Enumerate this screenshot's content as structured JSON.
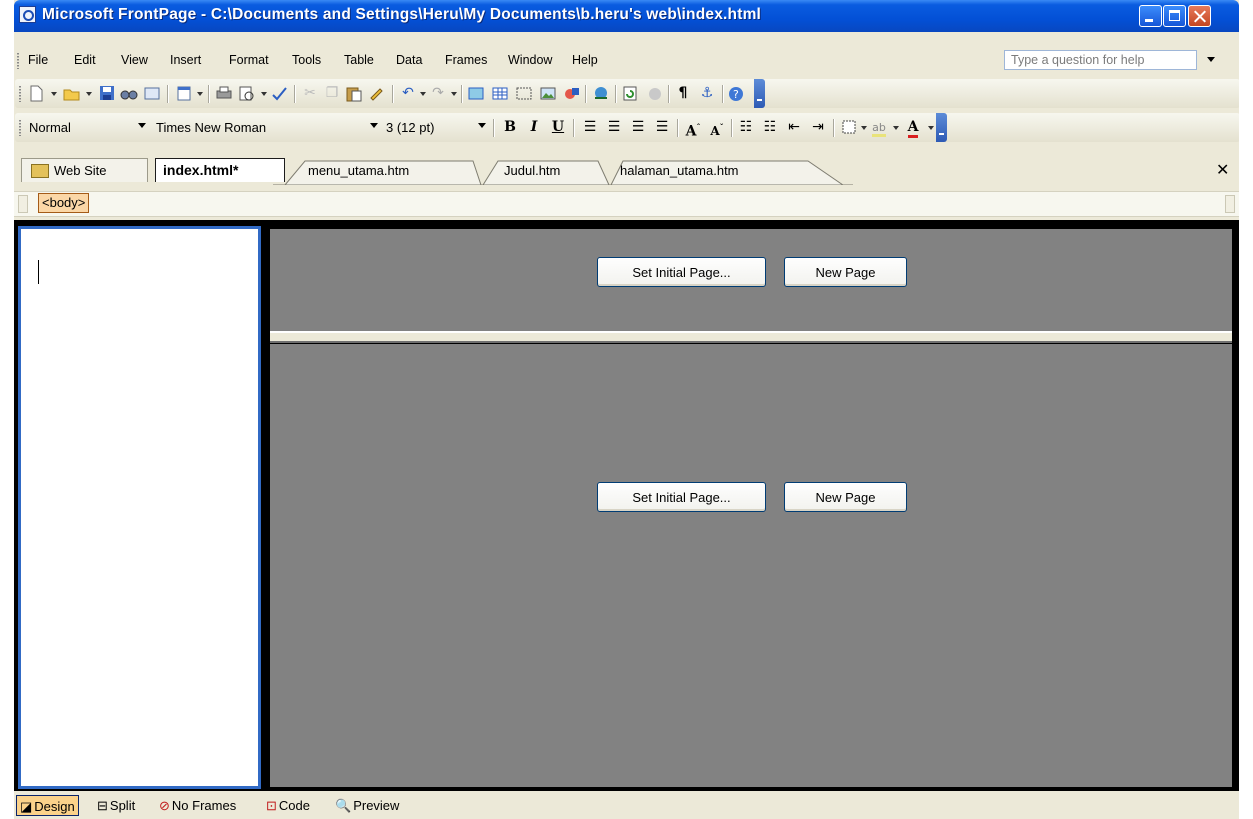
{
  "window": {
    "title": "Microsoft FrontPage - C:\\Documents and Settings\\Heru\\My Documents\\b.heru's web\\index.html"
  },
  "menu": {
    "items": [
      "File",
      "Edit",
      "View",
      "Insert",
      "Format",
      "Tools",
      "Table",
      "Data",
      "Frames",
      "Window",
      "Help"
    ],
    "help_placeholder": "Type a question for help"
  },
  "formatting": {
    "style": "Normal",
    "font": "Times New Roman",
    "size": "3 (12 pt)"
  },
  "tabs": {
    "website": "Web Site",
    "documents": [
      "index.html*",
      "menu_utama.htm",
      "Judul.htm",
      "halaman_utama.htm"
    ]
  },
  "quick_tag": "<body>",
  "frames": {
    "set_initial_page": "Set Initial Page...",
    "new_page": "New Page"
  },
  "views": {
    "design": "Design",
    "split": "Split",
    "no_frames": "No Frames",
    "code": "Code",
    "preview": "Preview"
  },
  "colors": {
    "title_bar": "#0350d6",
    "frame_background": "#828282",
    "selected_frame_border": "#316ac5",
    "quick_tag": "#fbd7a7"
  }
}
